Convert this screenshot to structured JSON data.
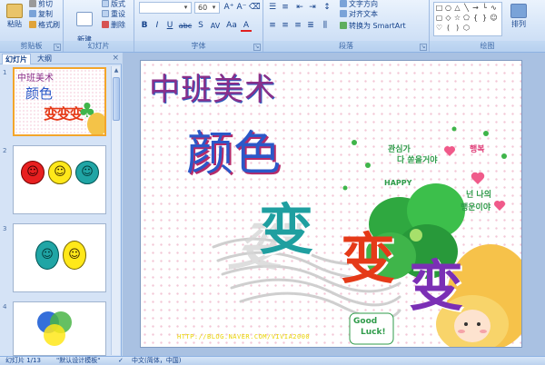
{
  "ribbon": {
    "clipboard": {
      "paste_label": "粘贴",
      "cut_label": "剪切",
      "copy_label": "复制",
      "format_painter_label": "格式刷",
      "group_label": "剪贴板"
    },
    "slides": {
      "new_slide_label": "新建\n幻灯片",
      "layout_label": "版式",
      "reset_label": "重设",
      "delete_label": "删除",
      "group_label": "幻灯片"
    },
    "font": {
      "font_name_value": "",
      "font_size_value": "60",
      "bold": "B",
      "italic": "I",
      "underline": "U",
      "strike": "abc",
      "shadow": "S",
      "spacing": "AV",
      "case": "Aa",
      "color": "A",
      "group_label": "字体"
    },
    "paragraph": {
      "text_direction_label": "文字方向",
      "align_text_label": "对齐文本",
      "smartart_label": "转换为 SmartArt",
      "group_label": "段落"
    },
    "drawing": {
      "arrange_label": "排列",
      "group_label": "绘图"
    }
  },
  "panel": {
    "tab_slides": "幻灯片",
    "tab_outline": "大纲",
    "close_glyph": "×",
    "thumbnails": [
      {
        "number": "1",
        "title": "中班美术",
        "line1": "颜色",
        "line2": "变变变"
      },
      {
        "number": "2"
      },
      {
        "number": "3"
      },
      {
        "number": "4"
      }
    ]
  },
  "slide": {
    "title": "中班美术",
    "subtitle": "颜色",
    "word": "变",
    "url": "HTTP://BLOG.NAVER.COM/VIVIA2000",
    "deco": {
      "kor1": "관심가",
      "kor2": "다 쏟을거야",
      "kor3": "행복",
      "kor4": "넌 나의",
      "kor5": "행운이야",
      "happy": "HAPPY",
      "good": "Good",
      "luck": "Luck!"
    }
  },
  "status": {
    "slide_count": "幻灯片 1/13",
    "theme": "\"默认设计模板\"",
    "language": "中文(简体，中国)"
  },
  "colors": {
    "title_purple": "#8a2f8a",
    "subtitle_blue": "#2b58c8",
    "bian_teal": "#1f9fa0",
    "bian_red": "#e53a18",
    "bian_purple": "#7b2fb5",
    "ribbon_accent": "#15428b"
  }
}
